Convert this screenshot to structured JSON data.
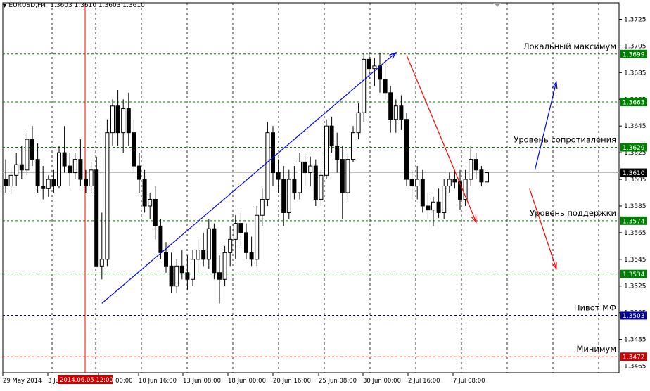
{
  "header": {
    "symbol_timeframe": "EURUSD,H4",
    "ohlc": "1.3603 1.3610 1.3603 1.3610"
  },
  "colors": {
    "up_candle": "#000000",
    "down_candle": "#000000",
    "level_line": "#008000",
    "pivot_line": "#00008b",
    "minimum_line": "#ff0000",
    "cursor_line": "#ff0000",
    "up_arrow": "#0000ff",
    "down_arrow": "#ff0000",
    "price_tag_green": "#008000",
    "price_tag_blue": "#00008b",
    "price_tag_red": "#cc0000",
    "current_price_tag": "#000000"
  },
  "chart_data": {
    "type": "candlestick",
    "symbol": "EURUSD",
    "timeframe": "H4",
    "ylim": [
      1.346,
      1.373
    ],
    "y_ticks": [
      "1.3725",
      "1.3705",
      "1.3685",
      "1.3665",
      "1.3645",
      "1.3625",
      "1.3605",
      "1.3585",
      "1.3565",
      "1.3545",
      "1.3525",
      "1.3505",
      "1.3485",
      "1.3465"
    ],
    "x_ticks": [
      "29 May 2014",
      "3 Jun",
      "6 Jun 00:00",
      "10 Jun 16:00",
      "13 Jun 08:00",
      "18 Jun 00:00",
      "20 Jun 16:00",
      "25 Jun 08:00",
      "30 Jun 00:00",
      "2 Jul 16:00",
      "7 Jul 08:00"
    ],
    "cursor_label": "2014.06.05 12:00",
    "current_price": "1.3610",
    "levels": [
      {
        "price": "1.3699",
        "label": "Локальный максимум",
        "kind": "level"
      },
      {
        "price": "1.3663",
        "label": "",
        "kind": "level"
      },
      {
        "price": "1.3629",
        "label": "Уровень сопротивления",
        "kind": "level"
      },
      {
        "price": "1.3574",
        "label": "Уровень поддержки",
        "kind": "level"
      },
      {
        "price": "1.3534",
        "label": "",
        "kind": "level"
      },
      {
        "price": "1.3503",
        "label": "Пивот МФ",
        "kind": "pivot"
      },
      {
        "price": "1.3472",
        "label": "Минимум",
        "kind": "minimum"
      }
    ],
    "candles": [
      [
        1.3605,
        1.362,
        1.3595,
        1.36
      ],
      [
        1.36,
        1.3612,
        1.3594,
        1.3608
      ],
      [
        1.3608,
        1.3625,
        1.36,
        1.3616
      ],
      [
        1.3616,
        1.363,
        1.3605,
        1.3612
      ],
      [
        1.3612,
        1.364,
        1.3608,
        1.3635
      ],
      [
        1.3635,
        1.3645,
        1.3615,
        1.362
      ],
      [
        1.362,
        1.3632,
        1.3595,
        1.36
      ],
      [
        1.36,
        1.3615,
        1.359,
        1.3598
      ],
      [
        1.3598,
        1.3608,
        1.3592,
        1.3605
      ],
      [
        1.3605,
        1.3612,
        1.3595,
        1.36
      ],
      [
        1.36,
        1.363,
        1.3598,
        1.3625
      ],
      [
        1.3625,
        1.3645,
        1.361,
        1.3615
      ],
      [
        1.3615,
        1.3625,
        1.36,
        1.361
      ],
      [
        1.361,
        1.3625,
        1.3605,
        1.362
      ],
      [
        1.362,
        1.3635,
        1.36,
        1.3605
      ],
      [
        1.3605,
        1.3612,
        1.3595,
        1.36
      ],
      [
        1.36,
        1.3618,
        1.3595,
        1.3612
      ],
      [
        1.3612,
        1.3622,
        1.359,
        1.354
      ],
      [
        1.354,
        1.358,
        1.353,
        1.3545
      ],
      [
        1.3545,
        1.365,
        1.354,
        1.364
      ],
      [
        1.364,
        1.3665,
        1.363,
        1.366
      ],
      [
        1.366,
        1.3672,
        1.363,
        1.364
      ],
      [
        1.364,
        1.3665,
        1.3625,
        1.3658
      ],
      [
        1.3658,
        1.367,
        1.363,
        1.364
      ],
      [
        1.364,
        1.365,
        1.361,
        1.3615
      ],
      [
        1.3615,
        1.3625,
        1.3595,
        1.3605
      ],
      [
        1.3605,
        1.3612,
        1.358,
        1.3585
      ],
      [
        1.3585,
        1.3595,
        1.3575,
        1.359
      ],
      [
        1.359,
        1.36,
        1.356,
        1.357
      ],
      [
        1.357,
        1.3575,
        1.3545,
        1.355
      ],
      [
        1.355,
        1.3558,
        1.3535,
        1.354
      ],
      [
        1.354,
        1.355,
        1.352,
        1.3525
      ],
      [
        1.3525,
        1.3545,
        1.352,
        1.354
      ],
      [
        1.354,
        1.3552,
        1.353,
        1.3535
      ],
      [
        1.3535,
        1.3548,
        1.3522,
        1.353
      ],
      [
        1.353,
        1.3552,
        1.3525,
        1.3545
      ],
      [
        1.3545,
        1.356,
        1.3535,
        1.3552
      ],
      [
        1.3552,
        1.3565,
        1.354,
        1.3545
      ],
      [
        1.3545,
        1.3575,
        1.3538,
        1.3568
      ],
      [
        1.3568,
        1.3572,
        1.353,
        1.3535
      ],
      [
        1.3535,
        1.3548,
        1.3512,
        1.353
      ],
      [
        1.353,
        1.3555,
        1.3525,
        1.355
      ],
      [
        1.355,
        1.357,
        1.354,
        1.356
      ],
      [
        1.356,
        1.3578,
        1.3545,
        1.3572
      ],
      [
        1.3572,
        1.358,
        1.3555,
        1.3565
      ],
      [
        1.3565,
        1.3572,
        1.3545,
        1.355
      ],
      [
        1.355,
        1.3562,
        1.354,
        1.3545
      ],
      [
        1.3545,
        1.3585,
        1.354,
        1.3578
      ],
      [
        1.3578,
        1.3598,
        1.357,
        1.359
      ],
      [
        1.359,
        1.3648,
        1.3585,
        1.364
      ],
      [
        1.364,
        1.3645,
        1.36,
        1.361
      ],
      [
        1.361,
        1.362,
        1.3595,
        1.3605
      ],
      [
        1.3605,
        1.3615,
        1.357,
        1.358
      ],
      [
        1.358,
        1.3612,
        1.3575,
        1.3605
      ],
      [
        1.3605,
        1.3615,
        1.359,
        1.3595
      ],
      [
        1.3595,
        1.3625,
        1.359,
        1.3618
      ],
      [
        1.3618,
        1.3625,
        1.36,
        1.361
      ],
      [
        1.361,
        1.3622,
        1.36,
        1.3615
      ],
      [
        1.3615,
        1.362,
        1.3585,
        1.359
      ],
      [
        1.359,
        1.3612,
        1.3585,
        1.3608
      ],
      [
        1.3608,
        1.365,
        1.3605,
        1.3645
      ],
      [
        1.3645,
        1.3652,
        1.3625,
        1.363
      ],
      [
        1.363,
        1.364,
        1.361,
        1.362
      ],
      [
        1.362,
        1.363,
        1.3575,
        1.3595
      ],
      [
        1.3595,
        1.3625,
        1.359,
        1.362
      ],
      [
        1.362,
        1.3645,
        1.3618,
        1.364
      ],
      [
        1.364,
        1.3662,
        1.3635,
        1.3655
      ],
      [
        1.3655,
        1.37,
        1.3648,
        1.3695
      ],
      [
        1.3695,
        1.37,
        1.368,
        1.3688
      ],
      [
        1.3688,
        1.3696,
        1.3675,
        1.369
      ],
      [
        1.369,
        1.37,
        1.367,
        1.368
      ],
      [
        1.368,
        1.3692,
        1.3665,
        1.367
      ],
      [
        1.367,
        1.3675,
        1.364,
        1.365
      ],
      [
        1.365,
        1.3665,
        1.364,
        1.366
      ],
      [
        1.366,
        1.3668,
        1.3642,
        1.365
      ],
      [
        1.365,
        1.3655,
        1.36,
        1.3605
      ],
      [
        1.3605,
        1.3612,
        1.359,
        1.36
      ],
      [
        1.36,
        1.3615,
        1.359,
        1.3605
      ],
      [
        1.3605,
        1.3612,
        1.358,
        1.3585
      ],
      [
        1.3585,
        1.3595,
        1.3575,
        1.3582
      ],
      [
        1.3582,
        1.3592,
        1.357,
        1.3588
      ],
      [
        1.3588,
        1.3598,
        1.3576,
        1.358
      ],
      [
        1.358,
        1.3605,
        1.3575,
        1.36
      ],
      [
        1.36,
        1.361,
        1.3595,
        1.3605
      ],
      [
        1.3605,
        1.3612,
        1.3598,
        1.3603
      ],
      [
        1.3603,
        1.3612,
        1.3582,
        1.359
      ],
      [
        1.359,
        1.3612,
        1.3585,
        1.3605
      ],
      [
        1.3605,
        1.363,
        1.36,
        1.362
      ],
      [
        1.362,
        1.3625,
        1.3605,
        1.3612
      ],
      [
        1.3612,
        1.3615,
        1.36,
        1.3603
      ],
      [
        1.3603,
        1.361,
        1.3603,
        1.361
      ]
    ],
    "up_trend_arrow": {
      "from": {
        "bar": 18,
        "price": 1.3512
      },
      "to": {
        "bar": 73,
        "price": 1.37
      }
    },
    "down_trend_arrow": {
      "from": {
        "bar": 75,
        "price": 1.3698
      },
      "to": {
        "bar": 88,
        "price": 1.3573
      }
    },
    "forecast_up_arrow": {
      "from": {
        "bar": 99,
        "price": 1.3612
      },
      "to": {
        "bar": 103,
        "price": 1.3678
      }
    },
    "forecast_down_arrow": {
      "from": {
        "bar": 98,
        "price": 1.3598
      },
      "to": {
        "bar": 103,
        "price": 1.3538
      }
    }
  }
}
